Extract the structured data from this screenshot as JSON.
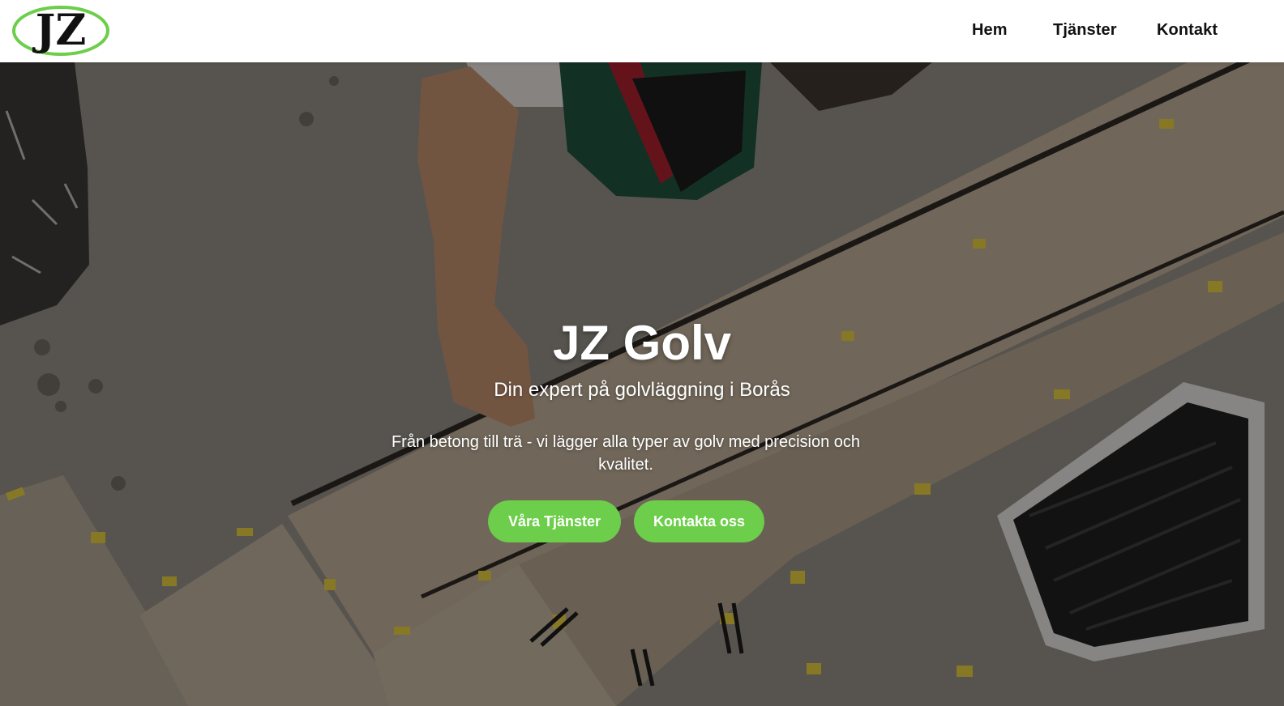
{
  "brand": {
    "logo_text": "JZ",
    "logo_ring_color": "#6cce4a"
  },
  "nav": {
    "items": [
      {
        "label": "Hem"
      },
      {
        "label": "Tjänster"
      },
      {
        "label": "Kontakt"
      }
    ]
  },
  "hero": {
    "title": "JZ Golv",
    "subtitle": "Din expert på golvläggning i Borås",
    "text": "Från betong till trä - vi lägger alla typer av golv med precision och kvalitet.",
    "buttons": {
      "services_label": "Våra Tjänster",
      "contact_label": "Kontakta oss"
    },
    "background": "photo-floor-installation",
    "accent_color": "#6cce4a"
  }
}
